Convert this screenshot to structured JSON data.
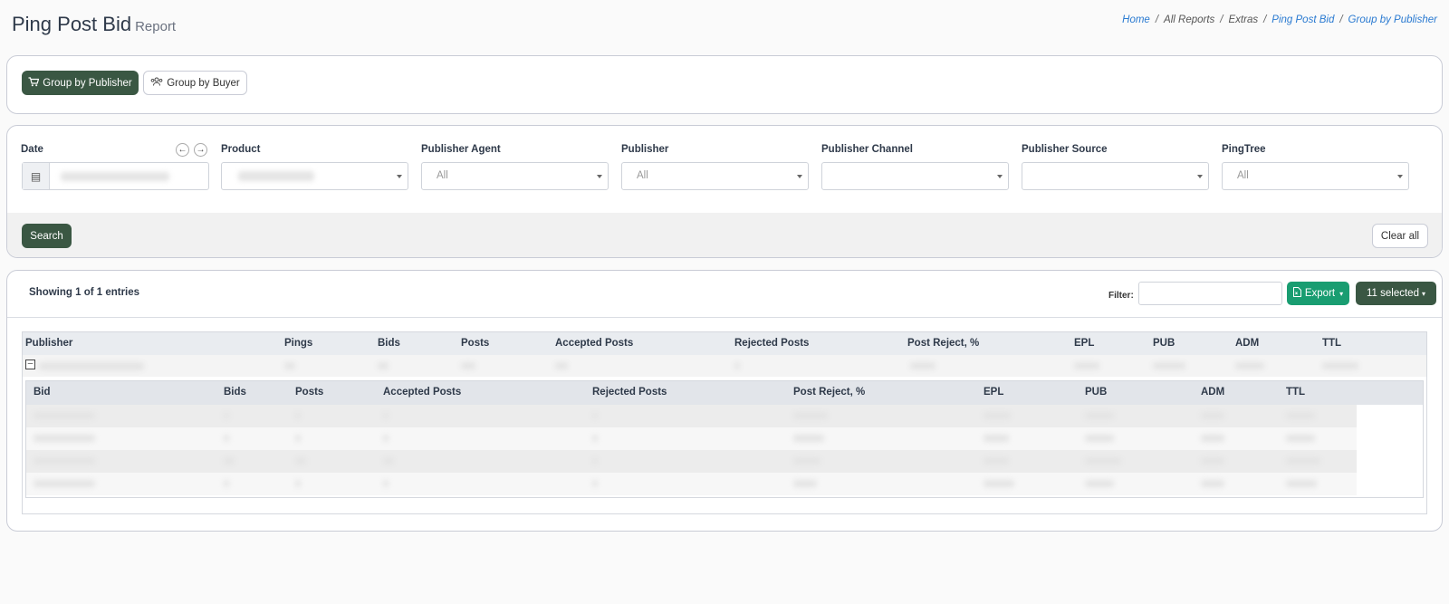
{
  "header": {
    "title": "Ping Post Bid",
    "subtitle": "Report"
  },
  "breadcrumb": [
    {
      "label": "Home",
      "link": true
    },
    {
      "label": "All Reports",
      "link": false
    },
    {
      "label": "Extras",
      "link": false
    },
    {
      "label": "Ping Post Bid",
      "link": true
    },
    {
      "label": "Group by Publisher",
      "link": true
    }
  ],
  "group_tabs": {
    "publisher": {
      "label": "Group by Publisher",
      "icon": "cart-icon",
      "active": true
    },
    "buyer": {
      "label": "Group by Buyer",
      "icon": "users-icon",
      "active": false
    }
  },
  "filters": {
    "date": {
      "label": "Date",
      "icon": "calendar-icon"
    },
    "product": {
      "label": "Product"
    },
    "publisher_agent": {
      "label": "Publisher Agent",
      "value": "All"
    },
    "publisher": {
      "label": "Publisher",
      "value": "All"
    },
    "publisher_channel": {
      "label": "Publisher Channel",
      "value": ""
    },
    "publisher_source": {
      "label": "Publisher Source",
      "value": ""
    },
    "pingtree": {
      "label": "PingTree",
      "value": "All"
    },
    "prev_icon": "arrow-left-icon",
    "next_icon": "arrow-right-icon",
    "search_label": "Search",
    "clear_label": "Clear all"
  },
  "results": {
    "showing": "Showing 1 of 1 entries",
    "filter_label": "Filter:",
    "export_label": "Export",
    "selected_label": "11 selected"
  },
  "table": {
    "columns": [
      "Publisher",
      "Pings",
      "Bids",
      "Posts",
      "Accepted Posts",
      "Rejected Posts",
      "Post Reject, %",
      "EPL",
      "PUB",
      "ADM",
      "TTL"
    ],
    "sub_columns": [
      "Bid",
      "Bids",
      "Posts",
      "Accepted Posts",
      "Rejected Posts",
      "Post Reject, %",
      "EPL",
      "PUB",
      "ADM",
      "TTL"
    ]
  },
  "colors": {
    "primary": "#3a5743",
    "export": "#199d71",
    "link": "#2a7ad1"
  }
}
